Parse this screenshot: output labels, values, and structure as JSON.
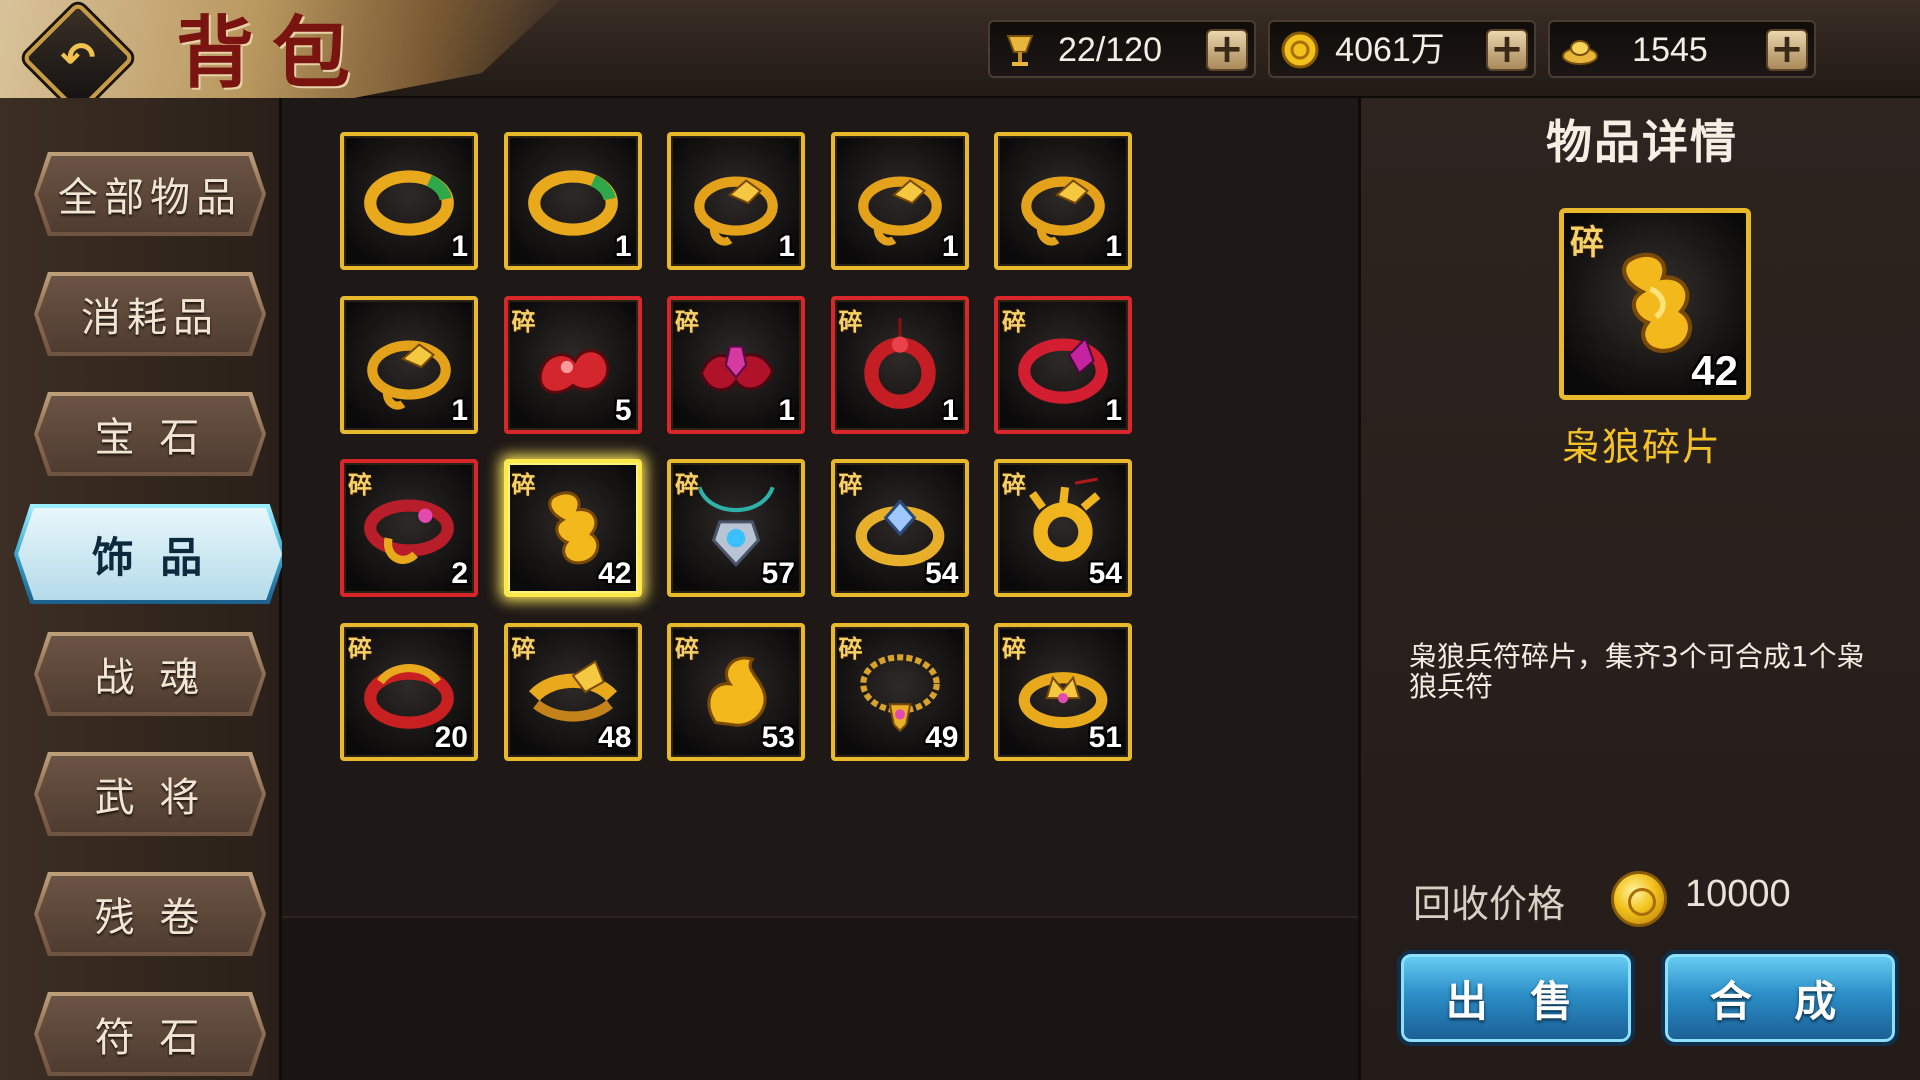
{
  "header": {
    "title": "背包",
    "resources": [
      {
        "icon": "cup-icon",
        "value": "22/120"
      },
      {
        "icon": "gold-coin-icon",
        "value": "4061万"
      },
      {
        "icon": "ingot-icon",
        "value": "1545"
      }
    ]
  },
  "sidebar": {
    "tabs": [
      {
        "label": "全部物品",
        "active": false
      },
      {
        "label": "消耗品",
        "active": false
      },
      {
        "label": "宝 石",
        "active": false
      },
      {
        "label": "饰 品",
        "active": true
      },
      {
        "label": "战 魂",
        "active": false
      },
      {
        "label": "武 将",
        "active": false
      },
      {
        "label": "残 卷",
        "active": false
      },
      {
        "label": "符 石",
        "active": false
      }
    ]
  },
  "grid": {
    "fragment_label": "碎",
    "items": [
      {
        "qty": "1",
        "frame": "gold",
        "fragment": false,
        "art": "ring-green"
      },
      {
        "qty": "1",
        "frame": "gold",
        "fragment": false,
        "art": "ring-green"
      },
      {
        "qty": "1",
        "frame": "gold",
        "fragment": false,
        "art": "fox-ring"
      },
      {
        "qty": "1",
        "frame": "gold",
        "fragment": false,
        "art": "fox-ring"
      },
      {
        "qty": "1",
        "frame": "gold",
        "fragment": false,
        "art": "fox-ring"
      },
      {
        "qty": "1",
        "frame": "gold",
        "fragment": false,
        "art": "fox-ring"
      },
      {
        "qty": "5",
        "frame": "red",
        "fragment": true,
        "art": "red-swirl"
      },
      {
        "qty": "1",
        "frame": "red",
        "fragment": true,
        "art": "red-gem"
      },
      {
        "qty": "1",
        "frame": "red",
        "fragment": true,
        "art": "red-pendant"
      },
      {
        "qty": "1",
        "frame": "red",
        "fragment": true,
        "art": "red-ring"
      },
      {
        "qty": "2",
        "frame": "red",
        "fragment": true,
        "art": "red-gold-ring"
      },
      {
        "qty": "42",
        "frame": "gold",
        "fragment": true,
        "art": "gold-tally",
        "selected": true
      },
      {
        "qty": "57",
        "frame": "gold",
        "fragment": true,
        "art": "necklace"
      },
      {
        "qty": "54",
        "frame": "gold",
        "fragment": true,
        "art": "gem-ring"
      },
      {
        "qty": "54",
        "frame": "gold",
        "fragment": true,
        "art": "gold-amulet"
      },
      {
        "qty": "20",
        "frame": "gold",
        "fragment": true,
        "art": "dragon-ring"
      },
      {
        "qty": "48",
        "frame": "gold",
        "fragment": true,
        "art": "wolf-ring"
      },
      {
        "qty": "53",
        "frame": "gold",
        "fragment": true,
        "art": "flame-charm"
      },
      {
        "qty": "49",
        "frame": "gold",
        "fragment": true,
        "art": "chain-necklace"
      },
      {
        "qty": "51",
        "frame": "gold",
        "fragment": true,
        "art": "crown-ring"
      }
    ]
  },
  "detail": {
    "title": "物品详情",
    "fragment_label": "碎",
    "qty": "42",
    "name": "枭狼碎片",
    "description": "枭狼兵符碎片，集齐3个可合成1个枭狼兵符",
    "price_label": "回收价格",
    "price_value": "10000",
    "sell_label": "出 售",
    "compose_label": "合 成"
  },
  "colors": {
    "gold_frame": "#e8b92a",
    "red_frame": "#d8262a",
    "name_color": "#f5c227",
    "active_tab": "#3aa8d6"
  }
}
